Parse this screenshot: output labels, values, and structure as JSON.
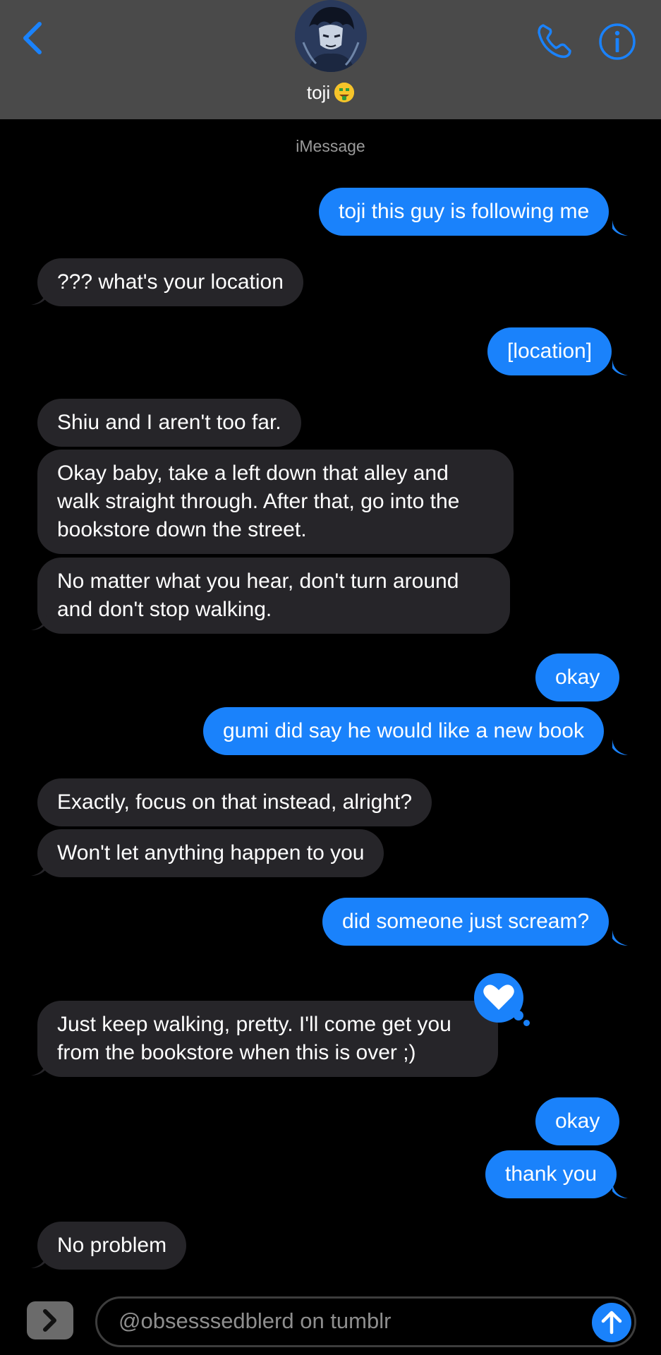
{
  "header": {
    "contact_name": "toji",
    "contact_emoji": "money-mouth-face-emoji",
    "back_icon": "chevron-left-icon",
    "call_icon": "phone-icon",
    "info_icon": "info-icon",
    "accent_color": "#1a82fb"
  },
  "thread": {
    "service_label": "iMessage",
    "messages": [
      {
        "from": "me",
        "text": "toji this guy is following me"
      },
      {
        "from": "them",
        "text": "??? what's your location"
      },
      {
        "from": "me",
        "text": "[location]"
      },
      {
        "from": "them",
        "text": "Shiu and I aren't too far."
      },
      {
        "from": "them",
        "text": "Okay baby, take a left down that alley and walk straight through. After that, go into the bookstore down the street."
      },
      {
        "from": "them",
        "text": "No matter what you hear, don't turn around and don't stop walking."
      },
      {
        "from": "me",
        "text": "okay"
      },
      {
        "from": "me",
        "text": "gumi did say he would like a new book"
      },
      {
        "from": "them",
        "text": "Exactly, focus on that instead, alright?"
      },
      {
        "from": "them",
        "text": "Won't let anything happen to you"
      },
      {
        "from": "me",
        "text": "did someone just scream?"
      },
      {
        "from": "them",
        "text": "Just keep walking, pretty. I'll come get you from the bookstore when this is over ;)",
        "reaction": "heart-icon"
      },
      {
        "from": "me",
        "text": "okay"
      },
      {
        "from": "me",
        "text": "thank you"
      },
      {
        "from": "them",
        "text": "No problem"
      }
    ]
  },
  "composer": {
    "apps_icon": "chevron-right-icon",
    "input_text": "@obsesssedblerd on tumblr",
    "send_icon": "arrow-up-icon"
  },
  "colors": {
    "outgoing_bubble": "#1a82fb",
    "incoming_bubble": "#262529",
    "header_bg": "#4a4a4a"
  }
}
